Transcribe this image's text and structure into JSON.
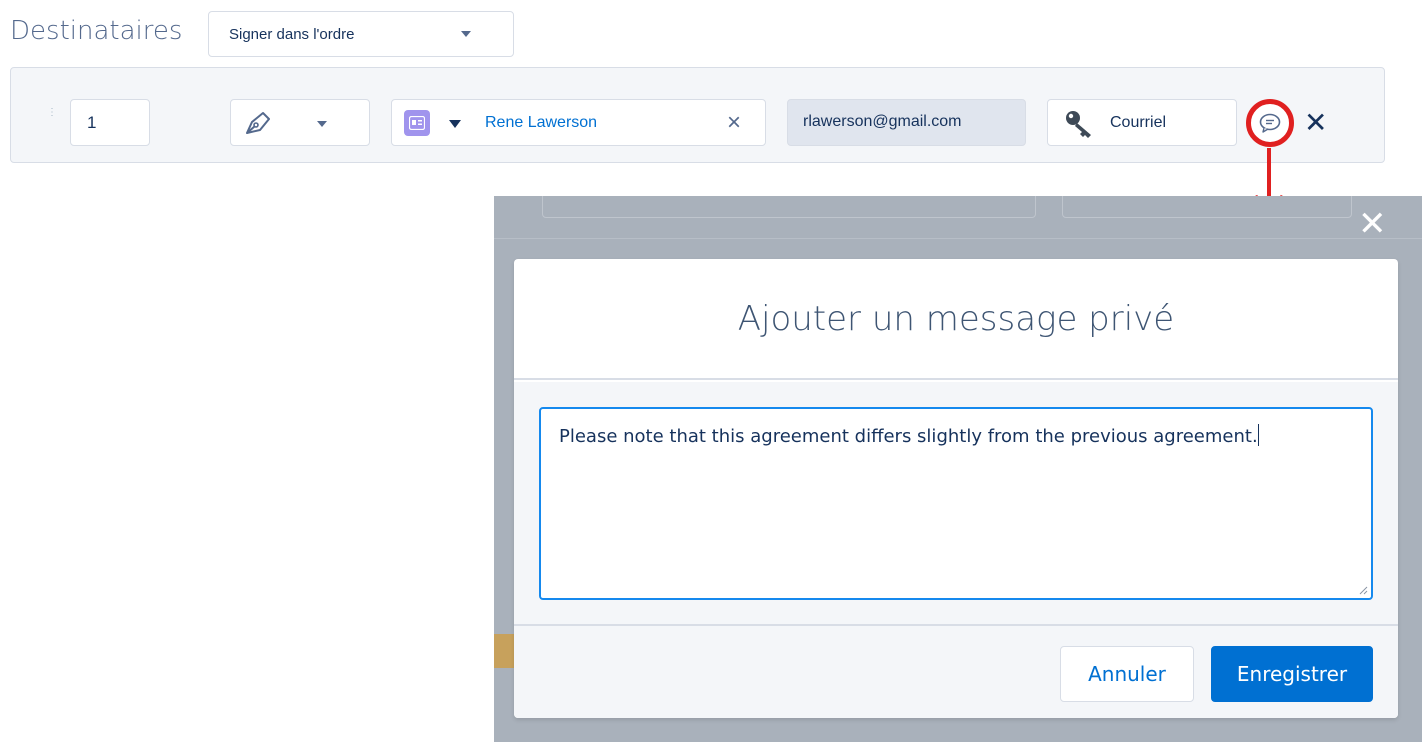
{
  "header": {
    "title": "Destinataires",
    "signing_order_value": "Signer dans l'ordre"
  },
  "recipient": {
    "order": "1",
    "role_icon": "pen-icon",
    "contact_icon": "contact-card-icon",
    "name": "Rene Lawerson",
    "email": "rlawerson@gmail.com",
    "auth_icon": "key-icon",
    "auth_method": "Courriel",
    "message_icon": "chat-bubble-icon",
    "remove_icon": "close-icon"
  },
  "modal": {
    "title": "Ajouter un message privé",
    "message": "Please note that this agreement differs slightly from the previous agreement.",
    "cancel_label": "Annuler",
    "save_label": "Enregistrer"
  },
  "colors": {
    "brand_blue": "#0070d2",
    "focus_blue": "#1589ee",
    "highlight_red": "#e02020",
    "contact_badge": "#a094ed"
  }
}
